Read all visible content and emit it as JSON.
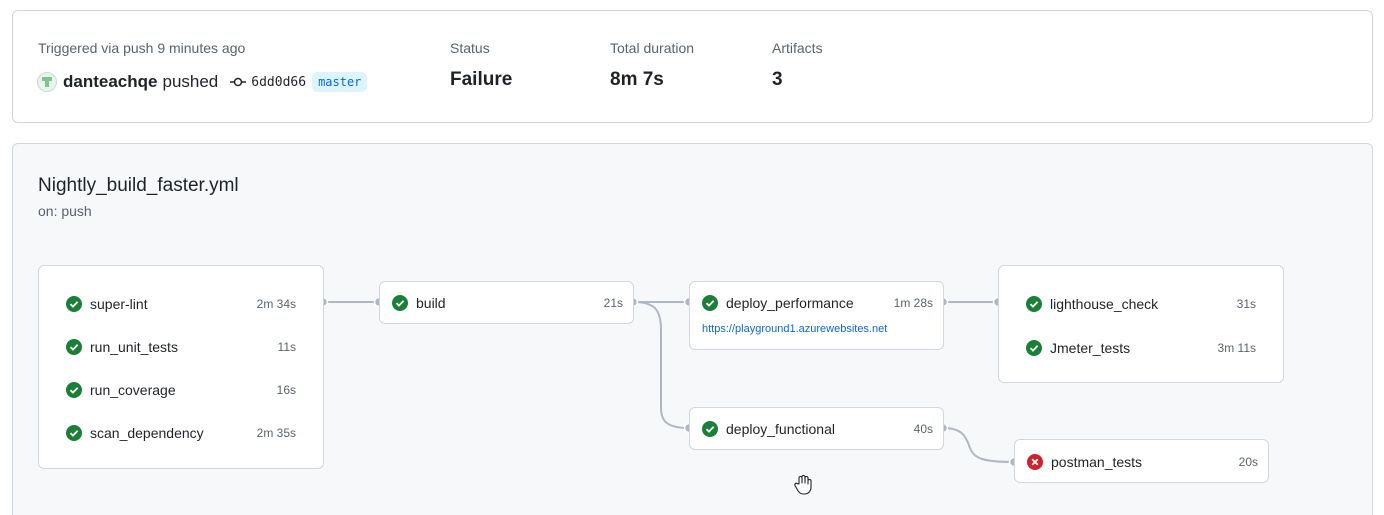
{
  "summary": {
    "trigger_label": "Triggered via push 9 minutes ago",
    "actor": "danteachqe",
    "action": "pushed",
    "commit_sha": "6dd0d66",
    "branch": "master",
    "status_label": "Status",
    "status_value": "Failure",
    "duration_label": "Total duration",
    "duration_value": "8m 7s",
    "artifacts_label": "Artifacts",
    "artifacts_value": "3"
  },
  "workflow": {
    "title": "Nightly_build_faster.yml",
    "subtitle": "on: push",
    "groups": {
      "lint": [
        {
          "name": "super-lint",
          "duration": "2m 34s",
          "status": "success"
        },
        {
          "name": "run_unit_tests",
          "duration": "11s",
          "status": "success"
        },
        {
          "name": "run_coverage",
          "duration": "16s",
          "status": "success"
        },
        {
          "name": "scan_dependency",
          "duration": "2m 35s",
          "status": "success"
        }
      ],
      "build": {
        "name": "build",
        "duration": "21s",
        "status": "success"
      },
      "deploy_performance": {
        "name": "deploy_performance",
        "duration": "1m 28s",
        "status": "success",
        "url": "https://playground1.azurewebsites.net"
      },
      "deploy_functional": {
        "name": "deploy_functional",
        "duration": "40s",
        "status": "success"
      },
      "perf_tests": [
        {
          "name": "lighthouse_check",
          "duration": "31s",
          "status": "success"
        },
        {
          "name": "Jmeter_tests",
          "duration": "3m 11s",
          "status": "success"
        }
      ],
      "postman": {
        "name": "postman_tests",
        "duration": "20s",
        "status": "failure"
      }
    }
  },
  "colors": {
    "success": "#1a7f37",
    "failure": "#cf222e",
    "link": "#0969da",
    "branch_bg": "#ddf4ff"
  }
}
